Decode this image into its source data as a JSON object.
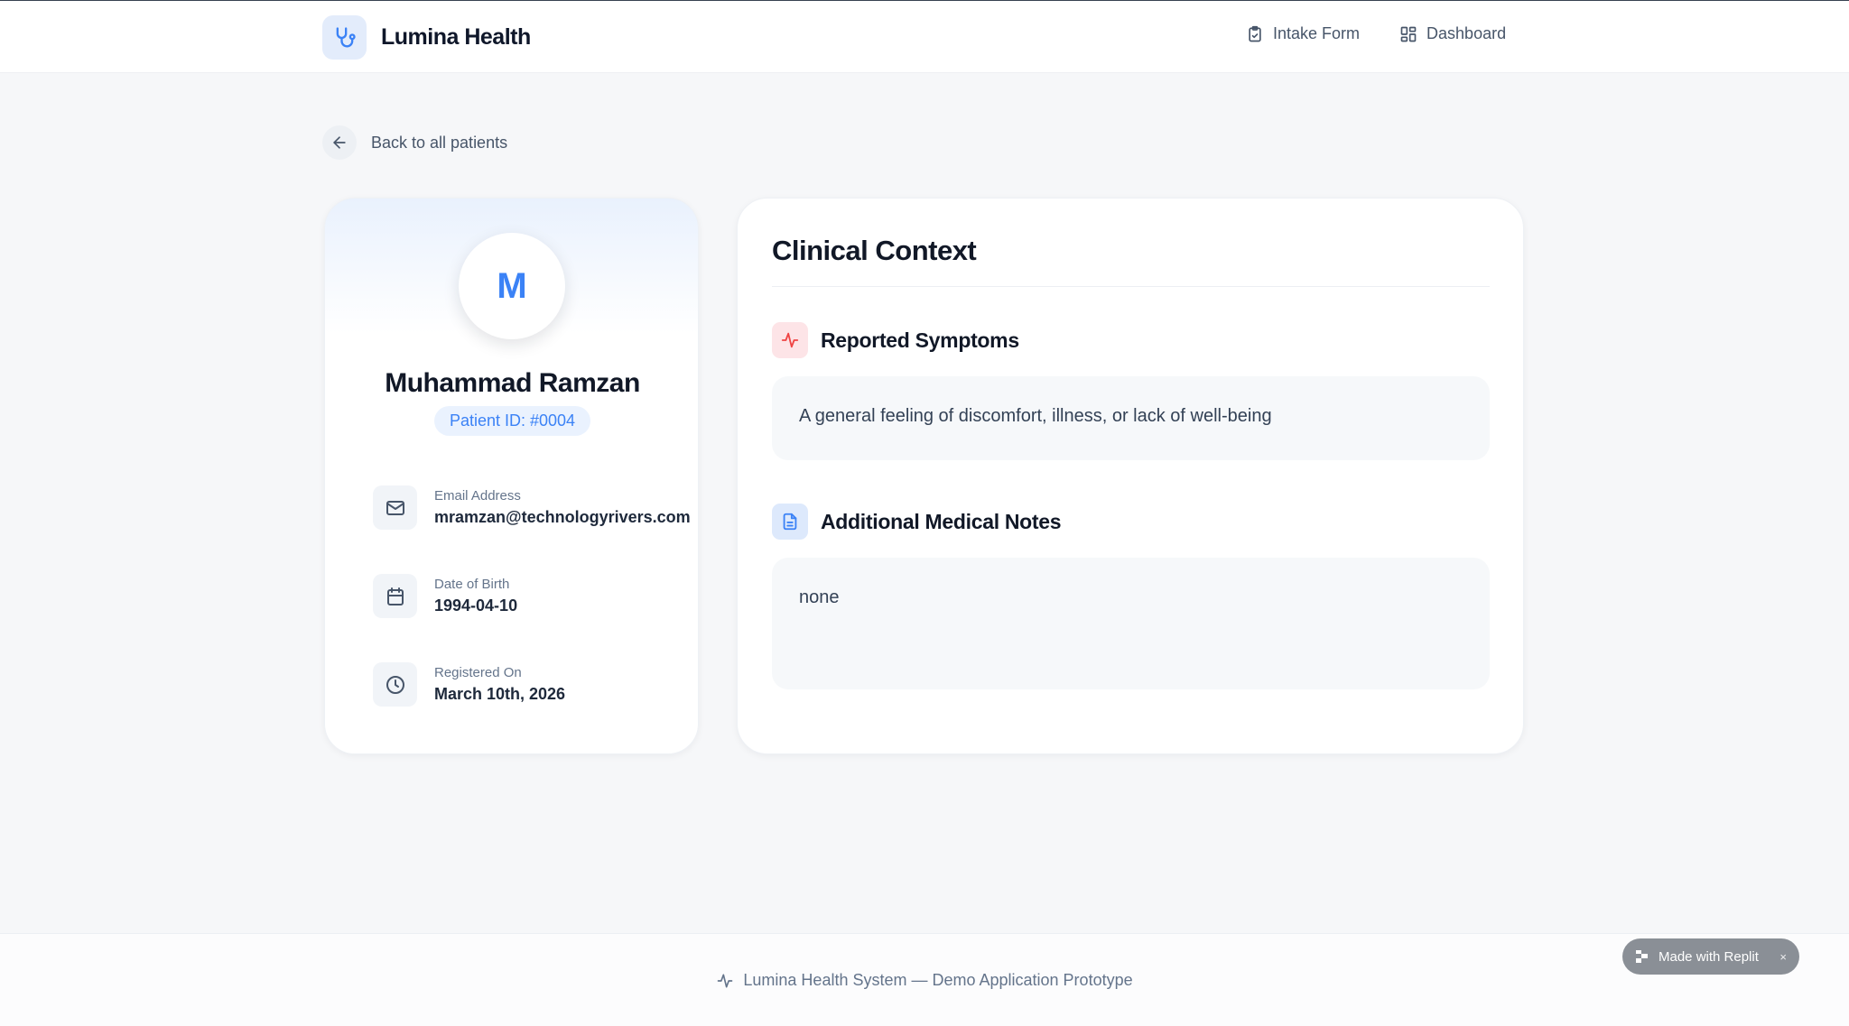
{
  "header": {
    "brand": "Lumina Health",
    "nav": [
      {
        "label": "Intake Form",
        "icon": "clipboard-icon"
      },
      {
        "label": "Dashboard",
        "icon": "dashboard-icon"
      }
    ]
  },
  "back_link": {
    "label": "Back to all patients",
    "icon": "arrow-left-icon"
  },
  "patient": {
    "initial": "M",
    "name": "Muhammad Ramzan",
    "id_badge": "Patient ID: #0004",
    "details": [
      {
        "label": "Email Address",
        "value": "mramzan@technologyrivers.com",
        "icon": "mail-icon"
      },
      {
        "label": "Date of Birth",
        "value": "1994-04-10",
        "icon": "calendar-icon"
      },
      {
        "label": "Registered On",
        "value": "March 10th, 2026",
        "icon": "clock-icon"
      }
    ]
  },
  "clinical": {
    "title": "Clinical Context",
    "symptoms": {
      "title": "Reported Symptoms",
      "text": "A general feeling of discomfort, illness, or lack of well-being",
      "icon": "activity-icon",
      "accent": "#ef4444"
    },
    "notes": {
      "title": "Additional Medical Notes",
      "text": "none",
      "icon": "document-icon",
      "accent": "#3b82f6"
    }
  },
  "footer": {
    "text": "Lumina Health System — Demo Application Prototype",
    "icon": "activity-icon"
  },
  "badge": {
    "label": "Made with Replit",
    "close": "×"
  },
  "colors": {
    "accent": "#3b82f6",
    "background": "#f6f7f9"
  }
}
